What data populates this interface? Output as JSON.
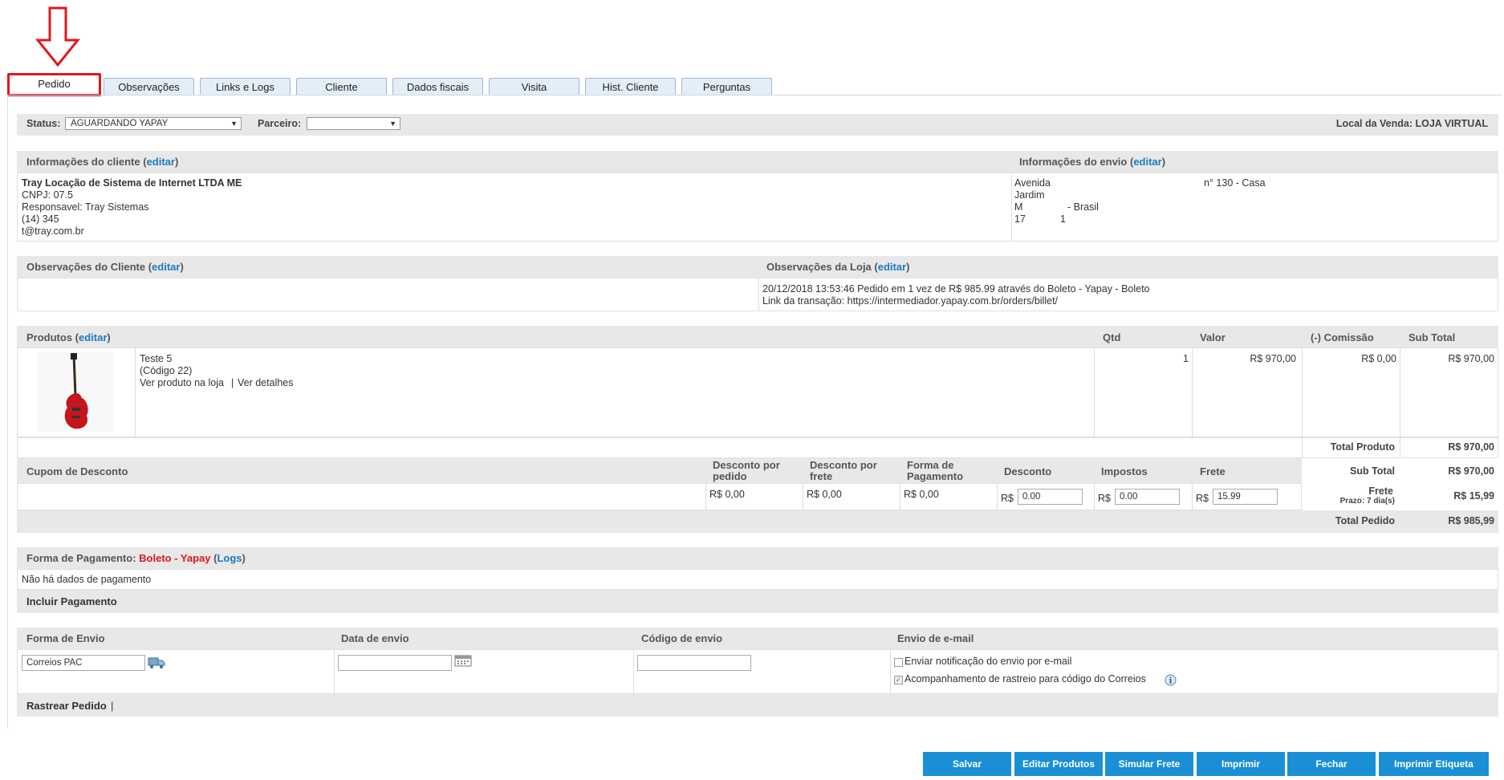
{
  "tabs": [
    "Pedido",
    "Observações",
    "Links e Logs",
    "Cliente",
    "Dados fiscais",
    "Visita",
    "Hist. Cliente",
    "Perguntas"
  ],
  "status": {
    "label": "Status:",
    "value": "AGUARDANDO YAPAY",
    "partner_label": "Parceiro:",
    "partner_value": "",
    "sale_place": "Local da Venda: LOJA VIRTUAL"
  },
  "client": {
    "title": "Informações do cliente (",
    "edit": "editar",
    "close": ")",
    "name": "Tray Locação de Sistema de Internet LTDA ME",
    "cnpj": "CNPJ: 07.5",
    "responsible": "Responsavel: Tray Sistemas",
    "phone": "(14) 345",
    "email": "t@tray.com.br"
  },
  "shipping": {
    "title": "Informações do envio (",
    "edit": "editar",
    "close": ")",
    "line1a": "Avenida",
    "line1b": "n° 130 - Casa",
    "line2": "Jardim",
    "line3a": "M",
    "line3b": "- Brasil",
    "line4a": "17",
    "line4b": "1"
  },
  "obs_client": {
    "title": "Observações do Cliente (",
    "edit": "editar",
    "close": ")"
  },
  "obs_store": {
    "title": "Observações da Loja (",
    "edit": "editar",
    "close": ")",
    "line1": "20/12/2018 13:53:46 Pedido em 1 vez de R$ 985.99 através do Boleto - Yapay - Boleto",
    "line2": "Link da transação: https://intermediador.yapay.com.br/orders/billet/"
  },
  "products": {
    "title": "Produtos (",
    "edit": "editar",
    "close": ")",
    "col_qty": "Qtd",
    "col_value": "Valor",
    "col_commission": "(-) Comissão",
    "col_subtotal": "Sub Total",
    "item": {
      "name": "Teste 5",
      "code": "(Código 22)",
      "link_store": "Ver produto na loja",
      "sep": "|",
      "link_details": "Ver detalhes",
      "qty": "1",
      "value": "R$ 970,00",
      "commission": "R$ 0,00",
      "subtotal": "R$ 970,00"
    },
    "total_product_label": "Total Produto",
    "total_product": "R$ 970,00"
  },
  "discount": {
    "coupon_label": "Cupom de Desconto",
    "col1": "Desconto por pedido",
    "col2": "Desconto por frete",
    "col3": "Forma de Pagamento",
    "col4": "Desconto",
    "col5": "Impostos",
    "col6": "Frete",
    "v1": "R$ 0,00",
    "v2": "R$ 0,00",
    "v3": "R$ 0,00",
    "currency": "R$",
    "desconto": "0.00",
    "impostos": "0.00",
    "frete": "15.99",
    "subtotal_label": "Sub Total",
    "subtotal": "R$ 970,00",
    "frete_label": "Frete",
    "prazo": "Prazo: 7 dia(s)",
    "frete_value": "R$ 15,99",
    "total_label": "Total Pedido",
    "total": "R$ 985,99"
  },
  "payment": {
    "label": "Forma de Pagamento:",
    "method": "Boleto - Yapay",
    "open": "(",
    "logs": "Logs",
    "close": ")",
    "no_data": "Não há dados de pagamento",
    "include": "Incluir Pagamento"
  },
  "delivery": {
    "col_form": "Forma de Envio",
    "col_date": "Data de envio",
    "col_code": "Código de envio",
    "col_email": "Envio de e-mail",
    "form_value": "Correios PAC",
    "date_value": "",
    "code_value": "",
    "notify": "Enviar notificação do envio por e-mail",
    "tracking": "Acompanhamento de rastreio para código do Correios",
    "track_link": "Rastrear Pedido",
    "track_sep": "|"
  },
  "buttons": [
    "Salvar",
    "Editar Produtos",
    "Simular Frete",
    "Imprimir",
    "Fechar",
    "Imprimir Etiqueta"
  ],
  "colors": {
    "accent": "#1a8fd6",
    "link": "#1a7bbf",
    "highlight": "#e0181e"
  }
}
